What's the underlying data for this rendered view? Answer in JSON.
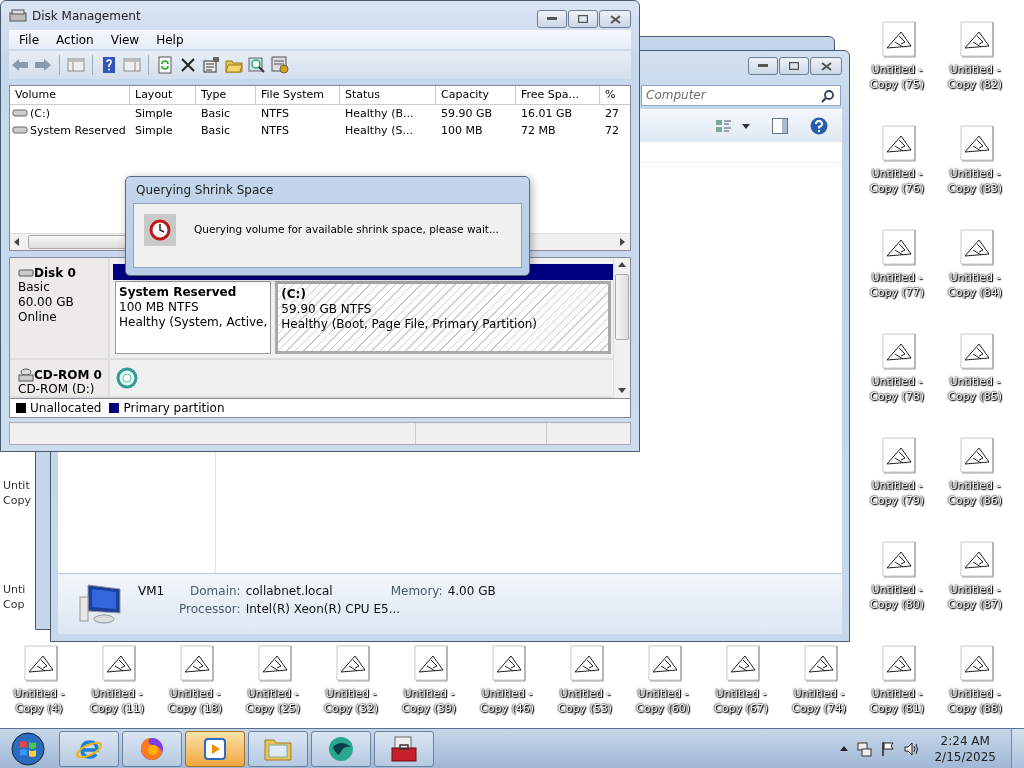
{
  "disk_management": {
    "title": "Disk Management",
    "menu": [
      "File",
      "Action",
      "View",
      "Help"
    ],
    "table": {
      "columns": [
        "Volume",
        "Layout",
        "Type",
        "File System",
        "Status",
        "Capacity",
        "Free Spa...",
        "%"
      ],
      "rows": [
        {
          "cells": [
            "(C:)",
            "Simple",
            "Basic",
            "NTFS",
            "Healthy (B...",
            "59.90 GB",
            "16.01 GB",
            "27"
          ]
        },
        {
          "cells": [
            "System Reserved",
            "Simple",
            "Basic",
            "NTFS",
            "Healthy (S...",
            "100 MB",
            "72 MB",
            "72"
          ]
        }
      ]
    },
    "disks": [
      {
        "kind": "disk",
        "name": "Disk 0",
        "lines": [
          "Basic",
          "60.00 GB",
          "Online"
        ],
        "partitions": [
          {
            "name": "System Reserved",
            "size": "100 MB NTFS",
            "status": "Healthy (System, Active,",
            "selected": false
          },
          {
            "name": "(C:)",
            "size": "59.90 GB NTFS",
            "status": "Healthy (Boot, Page File, Primary Partition)",
            "selected": true
          }
        ]
      },
      {
        "kind": "cdrom",
        "name": "CD-ROM 0",
        "lines": [
          "CD-ROM (D:)"
        ]
      }
    ],
    "legend": [
      {
        "label": "Unallocated",
        "color": "#000000"
      },
      {
        "label": "Primary partition",
        "color": "#000080"
      }
    ]
  },
  "dialog": {
    "title": "Querying Shrink Space",
    "message": "Querying volume for available shrink space, please wait..."
  },
  "explorer": {
    "search": {
      "placeholder": "Computer"
    },
    "details": {
      "name": "VM1",
      "fields": [
        {
          "label": "Domain:",
          "value": "collabnet.local"
        },
        {
          "label": "Memory:",
          "value": "4.00 GB"
        },
        {
          "label": "Processor:",
          "value": "Intel(R) Xeon(R) CPU E5..."
        }
      ]
    }
  },
  "desktop": {
    "columns": [
      {
        "icons": [
          {
            "kind": "partial",
            "lines": [
              "Untit",
              "Copy"
            ]
          },
          {
            "kind": "partial",
            "lines": [
              "Unti",
              "Cop"
            ]
          },
          {
            "kind": "file",
            "lines": [
              "Untitled -",
              "Copy (4)"
            ]
          }
        ]
      },
      {
        "icons": [
          {
            "kind": "file",
            "lines": [
              "Untitled -",
              "Copy (11)"
            ]
          }
        ]
      },
      {
        "icons": [
          {
            "kind": "file",
            "lines": [
              "Untitled -",
              "Copy (18)"
            ]
          }
        ]
      },
      {
        "icons": [
          {
            "kind": "file",
            "lines": [
              "Untitled -",
              "Copy (25)"
            ]
          }
        ]
      },
      {
        "icons": [
          {
            "kind": "file",
            "lines": [
              "Untitled -",
              "Copy (32)"
            ]
          }
        ]
      },
      {
        "icons": [
          {
            "kind": "file",
            "lines": [
              "Untitled -",
              "Copy (39)"
            ]
          }
        ]
      },
      {
        "icons": [
          {
            "kind": "file",
            "lines": [
              "Untitled -",
              "Copy (46)"
            ]
          }
        ]
      },
      {
        "icons": [
          {
            "kind": "file",
            "lines": [
              "Untitled -",
              "Copy (53)"
            ]
          }
        ]
      },
      {
        "icons": [
          {
            "kind": "file",
            "lines": [
              "Untitled -",
              "Copy (60)"
            ]
          }
        ]
      },
      {
        "icons": [
          {
            "kind": "file",
            "lines": [
              "Untitled -",
              "Copy (67)"
            ]
          }
        ]
      },
      {
        "icons": [
          {
            "kind": "file",
            "lines": [
              "Untitled -",
              "Copy (74)"
            ]
          }
        ]
      },
      {
        "icons": [
          {
            "kind": "file",
            "lines": [
              "Untitled -",
              "Copy (75)"
            ]
          },
          {
            "kind": "file",
            "lines": [
              "Untitled -",
              "Copy (76)"
            ]
          },
          {
            "kind": "file",
            "lines": [
              "Untitled -",
              "Copy (77)"
            ]
          },
          {
            "kind": "file",
            "lines": [
              "Untitled -",
              "Copy (78)"
            ]
          },
          {
            "kind": "file",
            "lines": [
              "Untitled -",
              "Copy (79)"
            ]
          },
          {
            "kind": "file",
            "lines": [
              "Untitled -",
              "Copy (80)"
            ]
          },
          {
            "kind": "file",
            "lines": [
              "Untitled -",
              "Copy (81)"
            ]
          }
        ]
      },
      {
        "icons": [
          {
            "kind": "file",
            "lines": [
              "Untitled -",
              "Copy (82)"
            ]
          },
          {
            "kind": "file",
            "lines": [
              "Untitled -",
              "Copy (83)"
            ]
          },
          {
            "kind": "file",
            "lines": [
              "Untitled -",
              "Copy (84)"
            ]
          },
          {
            "kind": "file",
            "lines": [
              "Untitled -",
              "Copy (85)"
            ]
          },
          {
            "kind": "file",
            "lines": [
              "Untitled -",
              "Copy (86)"
            ]
          },
          {
            "kind": "file",
            "lines": [
              "Untitled -",
              "Copy (87)"
            ]
          },
          {
            "kind": "file",
            "lines": [
              "Untitled -",
              "Copy (88)"
            ]
          }
        ]
      }
    ]
  },
  "taskbar": {
    "apps": [
      {
        "kind": "browser-e",
        "active": false
      },
      {
        "kind": "browser-fox",
        "active": false
      },
      {
        "kind": "media",
        "active": true
      },
      {
        "kind": "folder",
        "active": false
      },
      {
        "kind": "globe",
        "active": false
      },
      {
        "kind": "toolbox",
        "active": false
      }
    ],
    "time": "2:24 AM",
    "date": "2/15/2025"
  }
}
